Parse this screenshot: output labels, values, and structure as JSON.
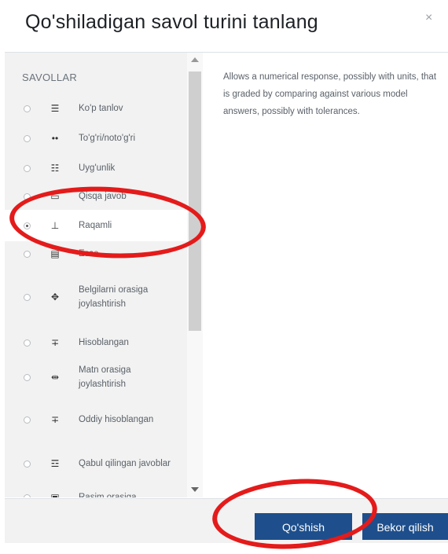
{
  "dialog": {
    "title": "Qo'shiladigan savol turini tanlang",
    "close_symbol": "×"
  },
  "options_panel": {
    "heading": "SAVOLLAR",
    "items": [
      {
        "label": "Ko'p tanlov",
        "icon": "multichoice-icon",
        "glyph": "☰",
        "selected": false
      },
      {
        "label": "To'g'ri/noto'g'ri",
        "icon": "truefalse-icon",
        "glyph": "••",
        "selected": false
      },
      {
        "label": "Uyg'unlik",
        "icon": "matching-icon",
        "glyph": "☷",
        "selected": false
      },
      {
        "label": "Qisqa javob",
        "icon": "shortanswer-icon",
        "glyph": "▭",
        "selected": false
      },
      {
        "label": "Raqamli",
        "icon": "numerical-icon",
        "glyph": "⊥",
        "selected": true
      },
      {
        "label": "Esse",
        "icon": "essay-icon",
        "glyph": "▤",
        "selected": false
      },
      {
        "label": "Belgilarni orasiga joylashtirish",
        "icon": "drag-drop-markers-icon",
        "glyph": "✥",
        "selected": false
      },
      {
        "label": "Hisoblangan",
        "icon": "calculated-icon",
        "glyph": "∓",
        "selected": false
      },
      {
        "label": "Matn orasiga joylashtirish",
        "icon": "drag-drop-text-icon",
        "glyph": "⇹",
        "selected": false
      },
      {
        "label": "Oddiy hisoblangan",
        "icon": "calculated-simple-icon",
        "glyph": "∓",
        "selected": false
      },
      {
        "label": "Qabul qilingan javoblar",
        "icon": "multianswer-icon",
        "glyph": "☲",
        "selected": false
      },
      {
        "label": "Rasim orasiga",
        "icon": "drag-drop-image-icon",
        "glyph": "▣",
        "selected": false
      }
    ]
  },
  "description": "Allows a numerical response, possibly with units, that is graded by comparing against various model answers, possibly with tolerances.",
  "footer": {
    "add_label": "Qo'shish",
    "cancel_label": "Bekor qilish"
  },
  "colors": {
    "primary_button": "#1e4f8c",
    "annotation": "#e41b1b"
  }
}
